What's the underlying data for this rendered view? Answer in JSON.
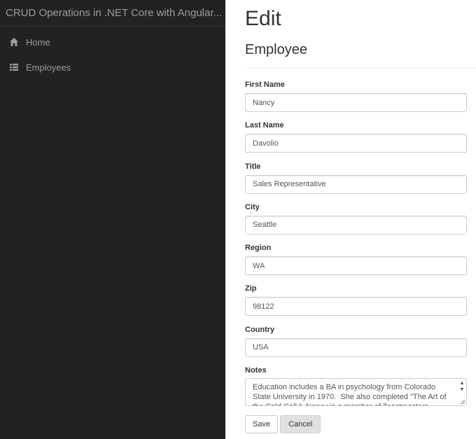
{
  "sidebar": {
    "brand": "CRUD Operations in .NET Core with Angular...",
    "items": [
      {
        "label": "Home",
        "icon": "home-icon"
      },
      {
        "label": "Employees",
        "icon": "list-icon"
      }
    ]
  },
  "main": {
    "title": "Edit",
    "subtitle": "Employee",
    "fields": {
      "first_name": {
        "label": "First Name",
        "value": "Nancy"
      },
      "last_name": {
        "label": "Last Name",
        "value": "Davolio"
      },
      "title": {
        "label": "Title",
        "value": "Sales Representative"
      },
      "city": {
        "label": "City",
        "value": "Seattle"
      },
      "region": {
        "label": "Region",
        "value": "WA"
      },
      "zip": {
        "label": "Zip",
        "value": "98122"
      },
      "country": {
        "label": "Country",
        "value": "USA"
      },
      "notes": {
        "label": "Notes",
        "value": "Education includes a BA in psychology from Colorado State University in 1970.  She also completed \"The Art of the Cold Call.\"  Nancy is a member of Toastmasters International."
      }
    },
    "buttons": {
      "save": "Save",
      "cancel": "Cancel"
    }
  },
  "colors": {
    "sidebar_bg": "#222222",
    "sidebar_text": "#9d9d9d"
  }
}
